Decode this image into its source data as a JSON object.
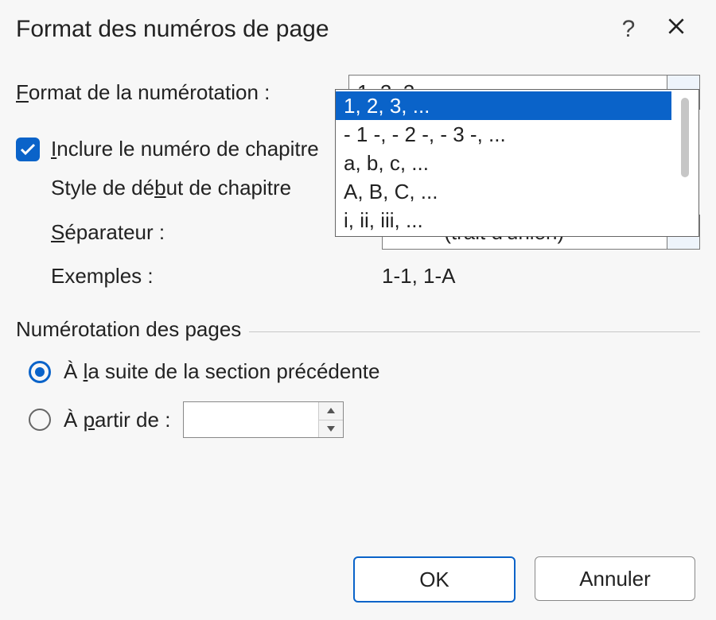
{
  "title": "Format des numéros de page",
  "format": {
    "label_pre": "F",
    "label_post": "ormat de la numérotation :",
    "selected": "1, 2, 3, ...",
    "options": [
      "1, 2, 3, ...",
      "- 1 -, - 2 -, - 3 -, ...",
      "a, b, c, ...",
      "A, B, C, ...",
      "i, ii, iii, ..."
    ]
  },
  "include_chapter": {
    "checked": true,
    "label_pre": "I",
    "label_post": "nclure le numéro de chapitre"
  },
  "chapter": {
    "style_label_a": "Style de dé",
    "style_label_u": "b",
    "style_label_b": "ut de chapitre",
    "sep_label_u": "S",
    "sep_label_rest": "éparateur :",
    "sep_value_symbol": "-",
    "sep_value_text": "(trait d'union)",
    "examples_label": "Exemples :",
    "examples_value": "1-1, 1-A"
  },
  "page_numbering": {
    "group_label": "Numérotation des pages",
    "opt_continue_a": "À ",
    "opt_continue_u": "l",
    "opt_continue_b": "a suite de la section précédente",
    "opt_start_a": "À ",
    "opt_start_u": "p",
    "opt_start_b": "artir de :",
    "selected": "continue",
    "start_value": ""
  },
  "buttons": {
    "ok": "OK",
    "cancel": "Annuler"
  }
}
